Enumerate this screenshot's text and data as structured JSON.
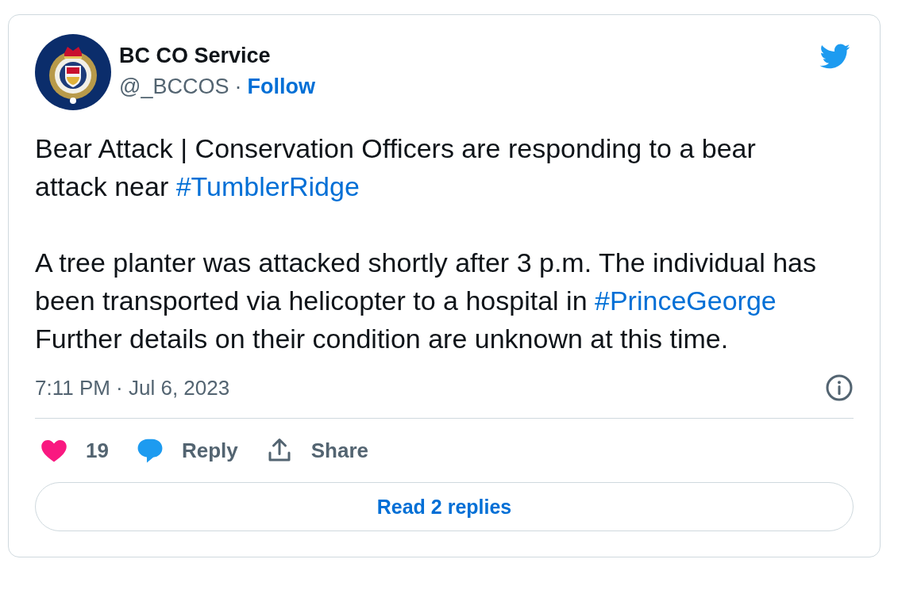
{
  "author": {
    "name": "BC CO Service",
    "handle": "@_BCCOS",
    "separator": "·",
    "follow": "Follow"
  },
  "paragraphs": [
    [
      {
        "kind": "text",
        "text": "Bear Attack | Conservation Officers are responding to a bear attack near "
      },
      {
        "kind": "hashtag",
        "text": "#TumblerRidge"
      }
    ],
    [
      {
        "kind": "text",
        "text": "A tree planter was attacked shortly after 3 p.m. The individual has been transported via helicopter to a hospital in "
      },
      {
        "kind": "hashtag",
        "text": "#PrinceGeorge"
      },
      {
        "kind": "text",
        "text": " Further details on their condition are unknown at this time."
      }
    ]
  ],
  "timestamp": "7:11 PM · Jul 6, 2023",
  "actions": [
    {
      "kind": "like",
      "label": "19"
    },
    {
      "kind": "reply",
      "label": "Reply"
    },
    {
      "kind": "share",
      "label": "Share"
    }
  ],
  "read_replies": "Read 2 replies"
}
